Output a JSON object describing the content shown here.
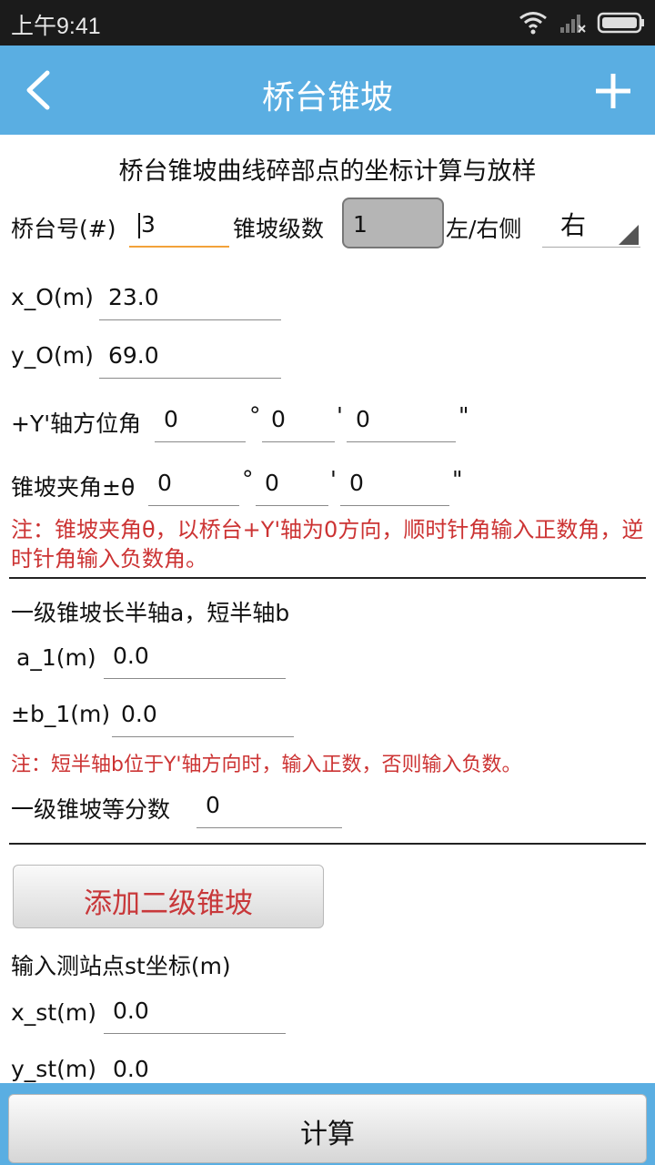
{
  "status_bar": {
    "time": "上午9:41"
  },
  "header": {
    "title": "桥台锥坡"
  },
  "form": {
    "heading": "桥台锥坡曲线碎部点的坐标计算与放样",
    "abutment_label": "桥台号(#)",
    "abutment_value": "3",
    "slope_level_label": "锥坡级数",
    "slope_level_value": "1",
    "side_label": "左/右侧",
    "side_value": "右",
    "x_o_label": "x_O(m)",
    "x_o_value": "23.0",
    "y_o_label": "y_O(m)",
    "y_o_value": "69.0",
    "azimuth_label": "+Y'轴方位角",
    "azimuth_deg": "0",
    "azimuth_min": "0",
    "azimuth_sec": "0",
    "theta_label": "锥坡夹角±θ",
    "theta_deg": "0",
    "theta_min": "0",
    "theta_sec": "0",
    "deg_symbol": "°",
    "min_symbol": "'",
    "sec_symbol": "\"",
    "note1": "注：锥坡夹角θ，以桥台+Y'轴为0方向，顺时针角输入正数角，逆时针角输入负数角。",
    "axis_heading": "一级锥坡长半轴a，短半轴b",
    "a1_label": "a_1(m)",
    "a1_value": "0.0",
    "b1_label": "±b_1(m)",
    "b1_value": "0.0",
    "note2": "注：短半轴b位于Y'轴方向时，输入正数，否则输入负数。",
    "divisions_label": "一级锥坡等分数",
    "divisions_value": "0",
    "add_level2_button": "添加二级锥坡",
    "station_heading": "输入测站点st坐标(m)",
    "x_st_label": "x_st(m)",
    "x_st_value": "0.0",
    "y_st_label": "y_st(m)",
    "y_st_value": "0.0"
  },
  "footer": {
    "calculate_button": "计算"
  },
  "colors": {
    "accent": "#5aaee2",
    "note_red": "#cc3333",
    "focus_orange": "#f2a23a"
  }
}
